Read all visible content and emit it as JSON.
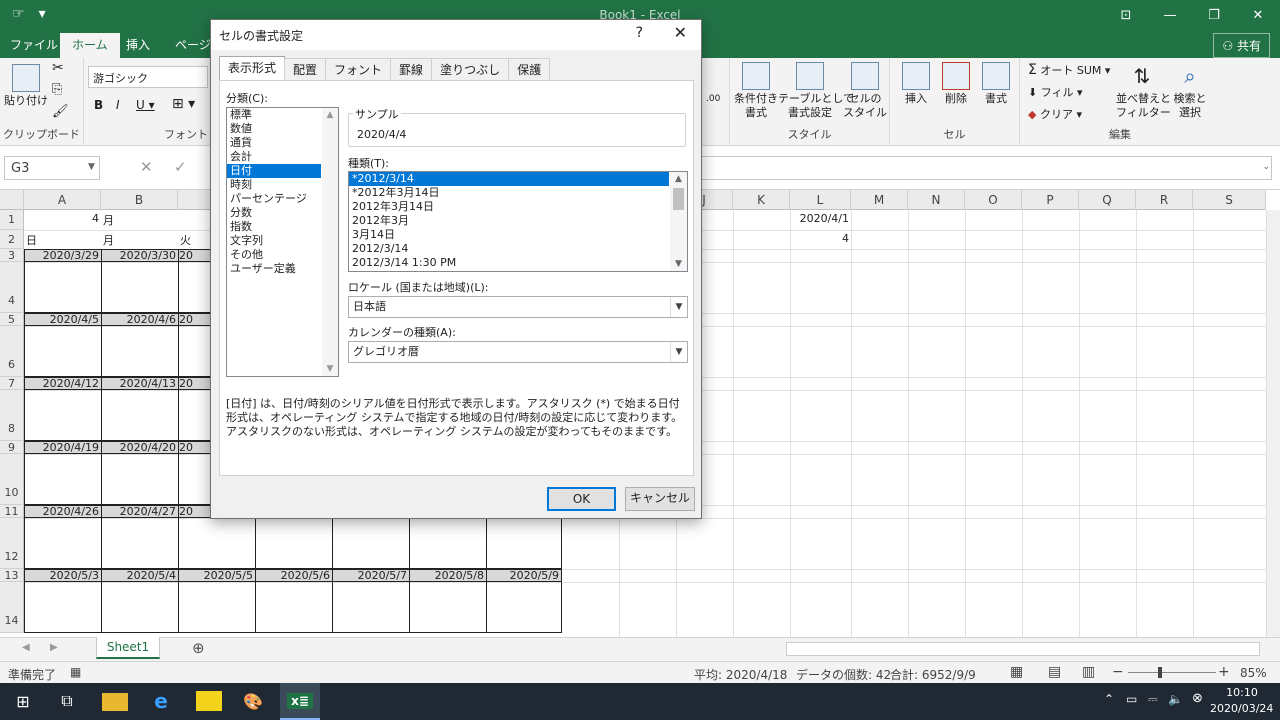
{
  "app": {
    "doc_title": "Book1 - Excel",
    "share_label": "共有",
    "tabs": [
      "ファイル",
      "ホーム",
      "挿入",
      "ページ"
    ]
  },
  "ribbon": {
    "paste_label": "貼り付け",
    "clipboard_label": "クリップボード",
    "font_name": "游ゴシック",
    "font_group_label": "フォント",
    "cond_format_label": "条件付き\n書式",
    "table_format_label": "テーブルとして\n書式設定",
    "cell_style_label": "セルの\nスタイル",
    "style_group_label": "スタイル",
    "insert_label": "挿入",
    "delete_label": "削除",
    "format_label": "書式",
    "cells_group_label": "セル",
    "autosum_label": "オート SUM",
    "fill_label": "フィル",
    "clear_label": "クリア",
    "sort_label": "並べ替えと\nフィルター",
    "find_label": "検索と\n選択",
    "edit_group_label": "編集"
  },
  "formula_bar": {
    "namebox": "G3"
  },
  "sheet": {
    "columns_left": [
      "A",
      "B"
    ],
    "columns_right": [
      "J",
      "K",
      "L",
      "M",
      "N",
      "O",
      "P",
      "Q",
      "R",
      "S"
    ],
    "row_labels": [
      "1",
      "2",
      "3",
      "4",
      "5",
      "6",
      "7",
      "8",
      "9",
      "10",
      "11",
      "12",
      "13",
      "14"
    ],
    "a1": "4",
    "b1": "月",
    "row2": [
      "日",
      "月",
      "火"
    ],
    "l1": "2020/4/1",
    "l2": "4",
    "week_rows": [
      [
        "2020/3/29",
        "2020/3/30",
        "20"
      ],
      [
        "2020/4/5",
        "2020/4/6",
        "20"
      ],
      [
        "2020/4/12",
        "2020/4/13",
        "20"
      ],
      [
        "2020/4/19",
        "2020/4/20",
        "20"
      ],
      [
        "2020/4/26",
        "2020/4/27",
        "20"
      ],
      [
        "2020/5/3",
        "2020/5/4",
        "2020/5/5",
        "2020/5/6",
        "2020/5/7",
        "2020/5/8",
        "2020/5/9"
      ]
    ]
  },
  "sheet_tab": "Sheet1",
  "status": {
    "ready": "準備完了",
    "average": "平均: 2020/4/18",
    "count": "データの個数: 42",
    "sum": "合計: 6952/9/9",
    "zoom": "85%"
  },
  "taskbar": {
    "time": "10:10",
    "date": "2020/03/24"
  },
  "dialog": {
    "title": "セルの書式設定",
    "help": "?",
    "tabs": [
      "表示形式",
      "配置",
      "フォント",
      "罫線",
      "塗りつぶし",
      "保護"
    ],
    "category_label": "分類(C):",
    "categories": [
      "標準",
      "数値",
      "通貨",
      "会計",
      "日付",
      "時刻",
      "パーセンテージ",
      "分数",
      "指数",
      "文字列",
      "その他",
      "ユーザー定義"
    ],
    "selected_category": "日付",
    "sample_label": "サンプル",
    "sample_value": "2020/4/4",
    "type_label": "種類(T):",
    "types": [
      "*2012/3/14",
      "*2012年3月14日",
      "2012年3月14日",
      "2012年3月",
      "3月14日",
      "2012/3/14",
      "2012/3/14 1:30 PM"
    ],
    "locale_label": "ロケール (国または地域)(L):",
    "locale_value": "日本語",
    "calendar_label": "カレンダーの種類(A):",
    "calendar_value": "グレゴリオ暦",
    "description": "[日付] は、日付/時刻のシリアル値を日付形式で表示します。アスタリスク (*) で始まる日付形式は、オペレーティング システムで指定する地域の日付/時刻の設定に応じて変わります。アスタリスクのない形式は、オペレーティング システムの設定が変わってもそのままです。",
    "ok": "OK",
    "cancel": "キャンセル"
  }
}
